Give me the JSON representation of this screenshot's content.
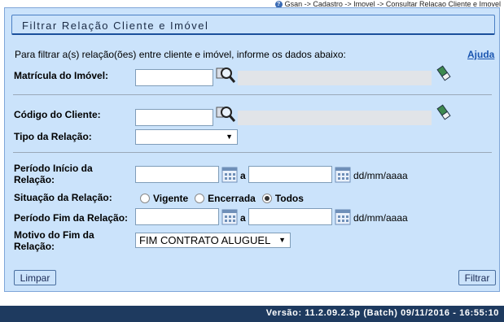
{
  "breadcrumb": "Gsan -> Cadastro -> Imovel -> Consultar Relacao Cliente e Imovel",
  "form": {
    "title": "Filtrar Relação Cliente e Imóvel",
    "instructions": "Para filtrar a(s) relação(ões) entre cliente e imóvel, informe os dados abaixo:",
    "help_link": "Ajuda",
    "matricula_label": "Matrícula do Imóvel:",
    "codigo_cliente_label": "Código do Cliente:",
    "tipo_relacao_label": "Tipo da Relação:",
    "tipo_relacao_value": "",
    "periodo_inicio_label_1": "Período Início da",
    "periodo_inicio_label_2": "Relação:",
    "range_sep": "a",
    "date_format": "dd/mm/aaaa",
    "situacao_label": "Situação da Relação:",
    "situacao_options": [
      "Vigente",
      "Encerrada",
      "Todos"
    ],
    "situacao_selected": "Todos",
    "periodo_fim_label": "Período Fim da Relação:",
    "motivo_fim_label_1": "Motivo do Fim da",
    "motivo_fim_label_2": "Relação:",
    "motivo_fim_value": "FIM CONTRATO ALUGUEL",
    "limpar_label": "Limpar",
    "filtrar_label": "Filtrar"
  },
  "footer": {
    "version": "Versão: 11.2.09.2.3p (Batch) 09/11/2016 - 16:55:10"
  },
  "icons": {
    "search": "magnifier-icon",
    "clear": "eraser-icon",
    "calendar": "calendar-icon"
  }
}
